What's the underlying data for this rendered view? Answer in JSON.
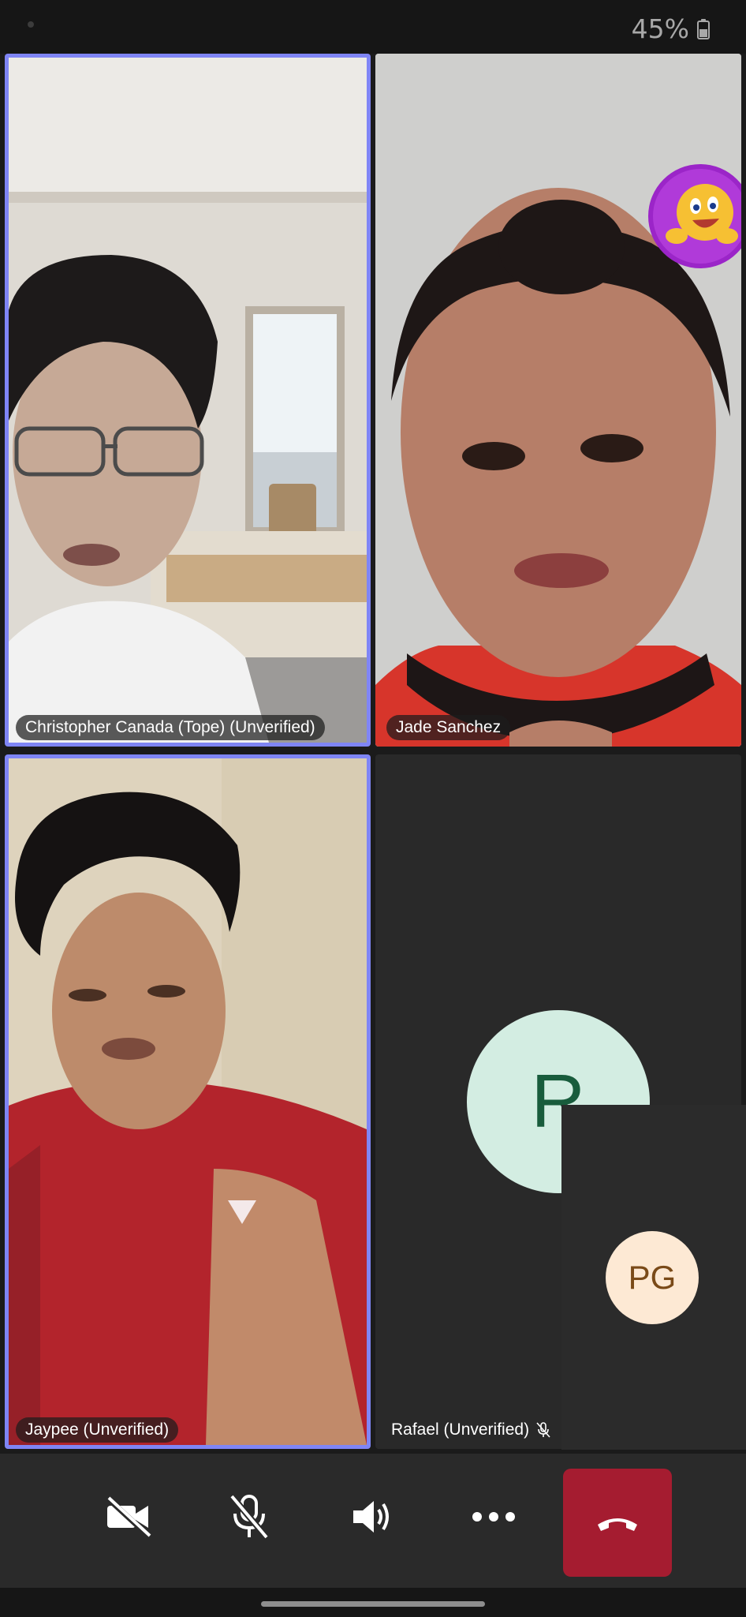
{
  "status_bar": {
    "battery_percent": "45%",
    "battery_icon": "battery-icon"
  },
  "participants": [
    {
      "name": "Christopher Canada (Tope) (Unverified)",
      "speaking": true,
      "video": true
    },
    {
      "name": "Jade Sanchez",
      "speaking": false,
      "video": true,
      "reaction": "laughing-emoji"
    },
    {
      "name": "Jaypee (Unverified)",
      "speaking": true,
      "video": true
    },
    {
      "name": "Rafael (Unverified)",
      "speaking": false,
      "video": false,
      "initials": "R",
      "muted": true
    }
  ],
  "self_view": {
    "initials": "PG"
  },
  "controls": {
    "camera": "video-off-icon",
    "microphone": "mic-off-icon",
    "speaker": "speaker-icon",
    "more": "more-options-icon",
    "hang_up": "end-call-icon"
  },
  "colors": {
    "active_speaker_border": "#7f85f5",
    "end_call": "#a51c30",
    "avatar_r_bg": "#d3ede2",
    "avatar_pg_bg": "#fde9d4"
  }
}
